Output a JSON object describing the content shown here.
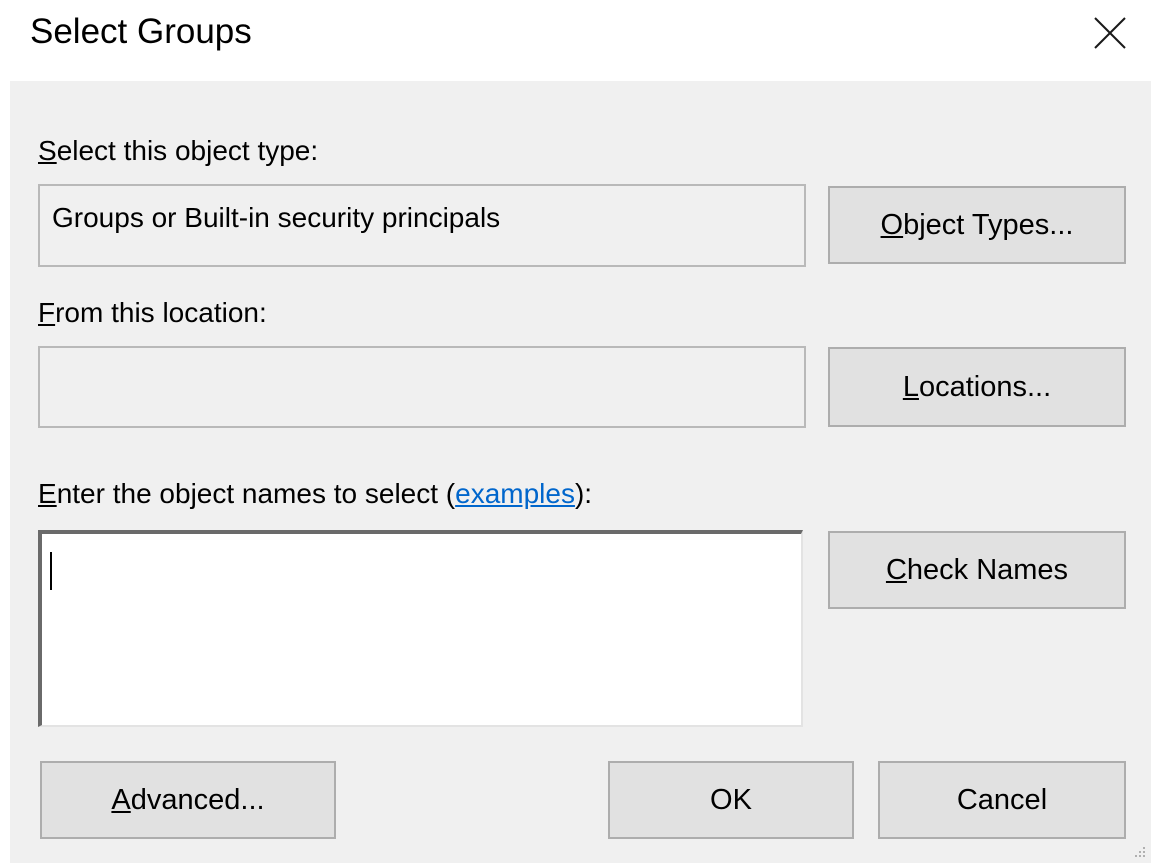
{
  "window": {
    "title": "Select Groups",
    "close_icon": "close-icon"
  },
  "object_type": {
    "label_mnemonic": "S",
    "label_rest": "elect this object type:",
    "value": "Groups or Built-in security principals",
    "button_mnemonic": "O",
    "button_rest": "bject Types..."
  },
  "location": {
    "label_mnemonic": "F",
    "label_rest": "rom this location:",
    "value": "",
    "button_mnemonic": "L",
    "button_rest": "ocations..."
  },
  "names": {
    "label_mnemonic": "E",
    "label_rest": "nter the object names to select (",
    "link": "examples",
    "label_end": "):",
    "value": "",
    "check_mnemonic": "C",
    "check_rest": "heck Names"
  },
  "footer": {
    "advanced_mnemonic": "A",
    "advanced_rest": "dvanced...",
    "ok_label": "OK",
    "cancel_label": "Cancel"
  },
  "colors": {
    "client_bg": "#f0f0f0",
    "button_bg": "#e1e1e1",
    "link": "#0066cc"
  }
}
